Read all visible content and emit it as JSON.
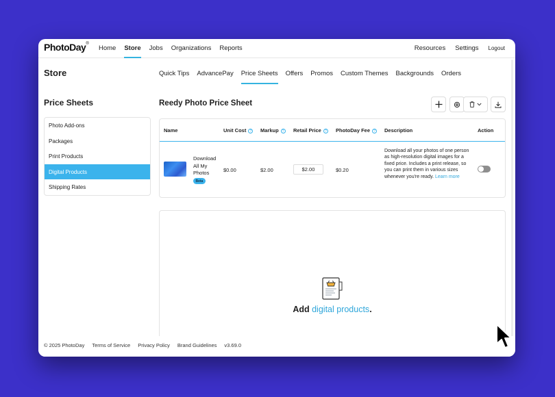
{
  "brand": {
    "logo": "PhotoDay",
    "tm": "®"
  },
  "topnav": {
    "left": [
      "Home",
      "Store",
      "Jobs",
      "Organizations",
      "Reports"
    ],
    "active": "Store",
    "right": [
      "Resources",
      "Settings"
    ],
    "logout": "Logout"
  },
  "store": {
    "title": "Store",
    "subnav": [
      "Quick Tips",
      "AdvancePay",
      "Price Sheets",
      "Offers",
      "Promos",
      "Custom Themes",
      "Backgrounds",
      "Orders"
    ],
    "active_subnav": "Price Sheets"
  },
  "sidebar": {
    "title": "Price Sheets",
    "items": [
      {
        "label": "Photo Add-ons",
        "active": false
      },
      {
        "label": "Packages",
        "active": false
      },
      {
        "label": "Print Products",
        "active": false
      },
      {
        "label": "Digital Products",
        "active": true
      },
      {
        "label": "Shipping Rates",
        "active": false
      }
    ]
  },
  "sheet": {
    "title": "Reedy Photo Price Sheet"
  },
  "table": {
    "headers": {
      "name": "Name",
      "unit_cost": "Unit Cost",
      "markup": "Markup",
      "retail_price": "Retail Price",
      "photoday_fee": "PhotoDay Fee",
      "description": "Description",
      "action": "Action"
    },
    "help_glyph": "?",
    "row": {
      "name": "Download All My Photos",
      "badge": "Beta",
      "unit_cost": "$0.00",
      "markup": "$2.00",
      "retail_price": "$2.00",
      "photoday_fee": "$0.20",
      "description": "Download all your photos of one person as high-resolution digital images for a fixed price. Includes a print release, so you can print them in various sizes whenever you're ready.",
      "learn_more": "Learn more",
      "enabled": false
    }
  },
  "empty_state": {
    "prefix": "Add",
    "highlight": "digital products",
    "suffix": "."
  },
  "footer": {
    "copyright": "© 2025 PhotoDay",
    "links": [
      "Terms of Service",
      "Privacy Policy",
      "Brand Guidelines"
    ],
    "version": "v3.69.0"
  },
  "colors": {
    "background": "#3c30c9",
    "accent": "#3bb3ec",
    "link": "#2fa6da"
  },
  "icons": [
    "plus-icon",
    "gear-icon",
    "trash-icon",
    "chevron-down-icon",
    "download-icon",
    "question-icon",
    "price-sheet-icon",
    "cursor-icon"
  ]
}
